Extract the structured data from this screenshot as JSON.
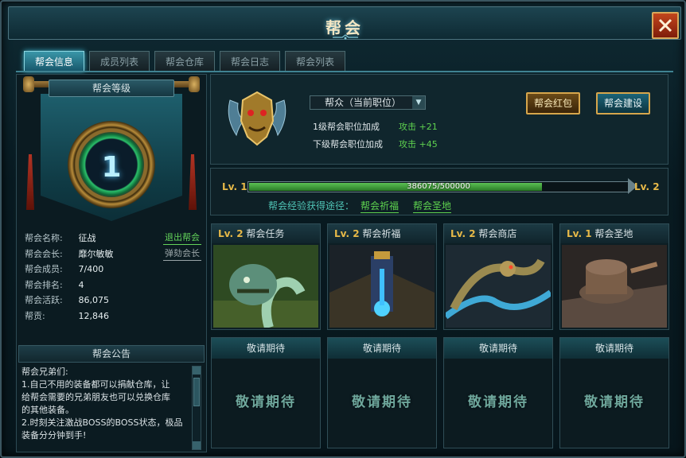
{
  "window": {
    "title": "帮会"
  },
  "tabs": [
    {
      "label": "帮会信息",
      "active": true
    },
    {
      "label": "成员列表",
      "active": false
    },
    {
      "label": "帮会仓库",
      "active": false
    },
    {
      "label": "帮会日志",
      "active": false
    },
    {
      "label": "帮会列表",
      "active": false
    }
  ],
  "guild_level": {
    "header": "帮会等级",
    "level": "1"
  },
  "guild_info": {
    "rows": [
      {
        "label": "帮会名称:",
        "value": "征战"
      },
      {
        "label": "帮会会长:",
        "value": "靡尔敏敏"
      },
      {
        "label": "帮会成员:",
        "value": "7/400"
      },
      {
        "label": "帮会排名:",
        "value": "4"
      },
      {
        "label": "帮会活跃:",
        "value": "86,075"
      },
      {
        "label": "帮贡:",
        "value": "12,846"
      }
    ],
    "leave_button": "退出帮会",
    "impeach_button": "弹劾会长"
  },
  "notice": {
    "header": "帮会公告",
    "lines": [
      "帮会兄弟们:",
      "1.自己不用的装备都可以捐献仓库，让",
      "给帮会需要的兄弟朋友也可以兑换仓库",
      "的其他装备。",
      "2.时刻关注激战BOSS的BOSS状态，极品",
      "装备分分钟到手!"
    ]
  },
  "position": {
    "current": "帮众（当前职位）",
    "bonus_label": "1级帮会职位加成",
    "bonus_value": "攻击 +21",
    "next_label": "下级帮会职位加成",
    "next_value": "攻击 +45",
    "red_packet_button": "帮会红包",
    "build_button": "帮会建设"
  },
  "experience": {
    "left_level": "Lv. 1",
    "right_level": "Lv. 2",
    "current": 386075,
    "max": 500000,
    "text": "386075/500000",
    "source_label": "帮会经验获得途径：",
    "link1": "帮会祈福",
    "link2": "帮会圣地"
  },
  "buildings": [
    {
      "level": "Lv. 2",
      "name": "帮会任务"
    },
    {
      "level": "Lv. 2",
      "name": "帮会祈福"
    },
    {
      "level": "Lv. 2",
      "name": "帮会商店"
    },
    {
      "level": "Lv. 1",
      "name": "帮会圣地"
    }
  ],
  "slots": [
    {
      "header": "敬请期待",
      "label": "敬请期待"
    },
    {
      "header": "敬请期待",
      "label": "敬请期待"
    },
    {
      "header": "敬请期待",
      "label": "敬请期待"
    },
    {
      "header": "敬请期待",
      "label": "敬请期待"
    }
  ],
  "colors": {
    "accent_gold": "#e7b948",
    "accent_green": "#5ed24f",
    "close_red": "#c2461d"
  }
}
